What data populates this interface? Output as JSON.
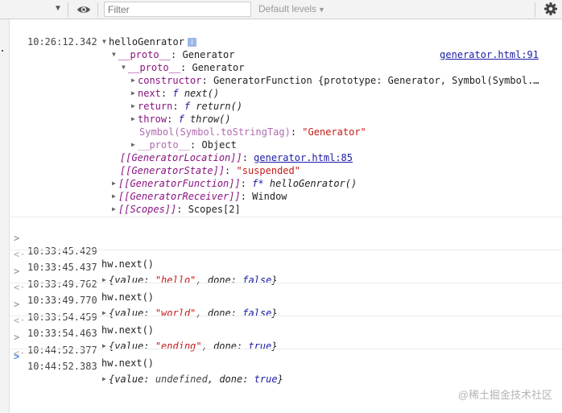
{
  "toolbar": {
    "filter_placeholder": "Filter",
    "levels_label": "Default levels"
  },
  "first": {
    "time": "10:26:12.342",
    "source": "generator.html:91",
    "title": "helloGenrator",
    "info": "i"
  },
  "tree": {
    "proto1_key": "__proto__",
    "proto1_val": "Generator",
    "proto2_key": "__proto__",
    "proto2_val": "Generator",
    "constructor_key": "constructor",
    "constructor_val": "GeneratorFunction {prototype: Generator, Symbol(Symbol.…",
    "next_key": "next",
    "next_f": "f",
    "next_val": "next()",
    "return_key": "return",
    "return_f": "f",
    "return_val": "return()",
    "throw_key": "throw",
    "throw_f": "f",
    "throw_val": "throw()",
    "symbol_key": "Symbol(Symbol.toStringTag)",
    "symbol_val": "\"Generator\"",
    "proto3_key": "__proto__",
    "proto3_val": "Object",
    "loc_key": "[[GeneratorLocation]]",
    "loc_val": "generator.html:85",
    "state_key": "[[GeneratorState]]",
    "state_val": "\"suspended\"",
    "func_key": "[[GeneratorFunction]]",
    "func_f": "f*",
    "func_val": "helloGenrator()",
    "recv_key": "[[GeneratorReceiver]]",
    "recv_val": "Window",
    "scopes_key": "[[Scopes]]",
    "scopes_val": "Scopes[2]"
  },
  "calls": [
    {
      "in_time": "10:33:45.429",
      "cmd": "hw.next()",
      "out_time": "10:33:45.437",
      "value": "\"hello\"",
      "done": "false"
    },
    {
      "in_time": "10:33:49.762",
      "cmd": "hw.next()",
      "out_time": "10:33:49.770",
      "value": "\"world\"",
      "done": "false"
    },
    {
      "in_time": "10:33:54.459",
      "cmd": "hw.next()",
      "out_time": "10:33:54.463",
      "value": "\"ending\"",
      "done": "true"
    },
    {
      "in_time": "10:44:52.377",
      "cmd": "hw.next()",
      "out_time": "10:44:52.383",
      "value": "undefined",
      "done": "true"
    }
  ],
  "labels": {
    "value_key": "value:",
    "done_key": "done:",
    "open": "{",
    "close": "}"
  },
  "watermark": "@稀土掘金技术社区"
}
